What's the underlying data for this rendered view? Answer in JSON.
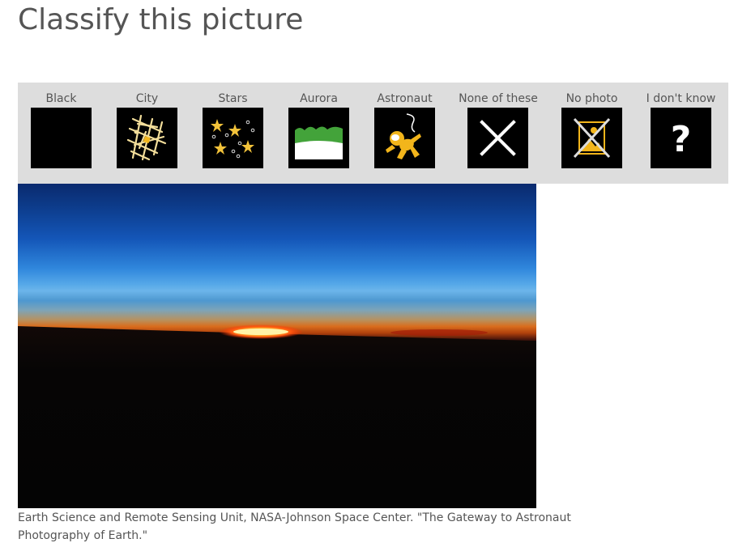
{
  "page": {
    "title": "Classify this picture"
  },
  "options": [
    {
      "label": "Black",
      "icon": "black-square-icon"
    },
    {
      "label": "City",
      "icon": "city-map-icon"
    },
    {
      "label": "Stars",
      "icon": "stars-icon"
    },
    {
      "label": "Aurora",
      "icon": "aurora-icon"
    },
    {
      "label": "Astronaut",
      "icon": "astronaut-icon"
    },
    {
      "label": "None of these",
      "icon": "x-mark-icon"
    },
    {
      "label": "No photo",
      "icon": "no-photo-icon"
    },
    {
      "label": "I don't know",
      "icon": "question-mark-icon"
    }
  ],
  "photo": {
    "subject": "sunset-over-earth-horizon"
  },
  "caption": {
    "text": "Earth Science and Remote Sensing Unit, NASA-Johnson Space Center. \"The Gateway to Astronaut Photography of Earth.\""
  },
  "colors": {
    "toolbar_bg": "#dddddd",
    "tile_bg": "#000000",
    "icon_yellow": "#f2b51b",
    "aurora_green": "#43a33a",
    "text_gray": "#555555"
  }
}
